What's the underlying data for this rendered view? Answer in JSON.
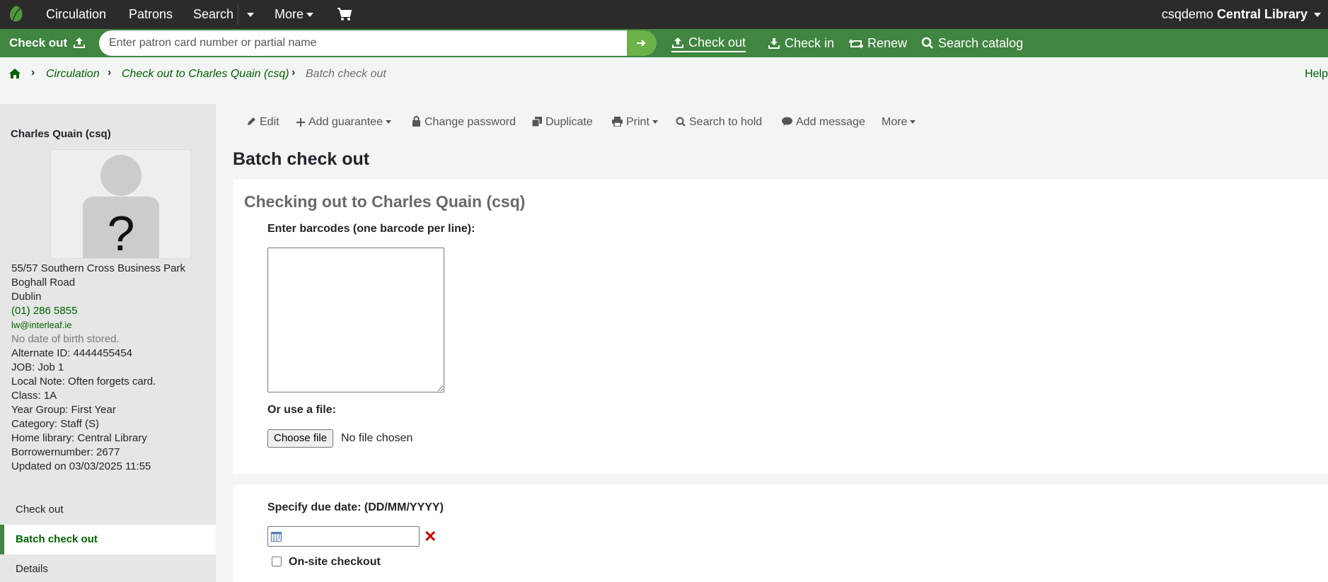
{
  "topnav": {
    "items": [
      "Circulation",
      "Patrons",
      "Search",
      "More"
    ],
    "user": "csqdemo",
    "library": "Central Library"
  },
  "checkout_bar": {
    "label": "Check out",
    "placeholder": "Enter patron card number or partial name",
    "tools": [
      "Check out",
      "Check in",
      "Renew",
      "Search catalog"
    ]
  },
  "breadcrumb": {
    "items": [
      "Circulation",
      "Check out to Charles Quain (csq)",
      "Batch check out"
    ],
    "help": "Help"
  },
  "patron": {
    "name": "Charles Quain (csq)",
    "address1": "55/57 Southern Cross Business Park",
    "address2": "Boghall Road",
    "city": "Dublin",
    "phone": "(01) 286 5855",
    "email": "lw@interleaf.ie",
    "dob": "No date of birth stored.",
    "alt_id": "Alternate ID: 4444455454",
    "job": "JOB: Job 1",
    "local_note": "Local Note: Often forgets card.",
    "class": "Class: 1A",
    "year_group": "Year Group: First Year",
    "category": "Category: Staff (S)",
    "home_library": "Home library: Central Library",
    "borrowernumber": "Borrowernumber: 2677",
    "updated": "Updated on 03/03/2025 11:55"
  },
  "sidebar_menu": [
    "Check out",
    "Batch check out",
    "Details"
  ],
  "toolbar": {
    "edit": "Edit",
    "add_guarantee": "Add guarantee",
    "change_password": "Change password",
    "duplicate": "Duplicate",
    "print": "Print",
    "search_to_hold": "Search to hold",
    "add_message": "Add message",
    "more": "More"
  },
  "page": {
    "title": "Batch check out",
    "checking_out_to": "Checking out to Charles Quain (csq)",
    "barcodes_label": "Enter barcodes (one barcode per line):",
    "file_label": "Or use a file:",
    "choose_file": "Choose file",
    "no_file": "No file chosen",
    "due_date_label": "Specify due date: (DD/MM/YYYY)",
    "onsite_label": "On-site checkout"
  },
  "colors": {
    "topnav_bg": "#2c2a2b",
    "green_bar": "#408540",
    "link_green": "#006100"
  }
}
